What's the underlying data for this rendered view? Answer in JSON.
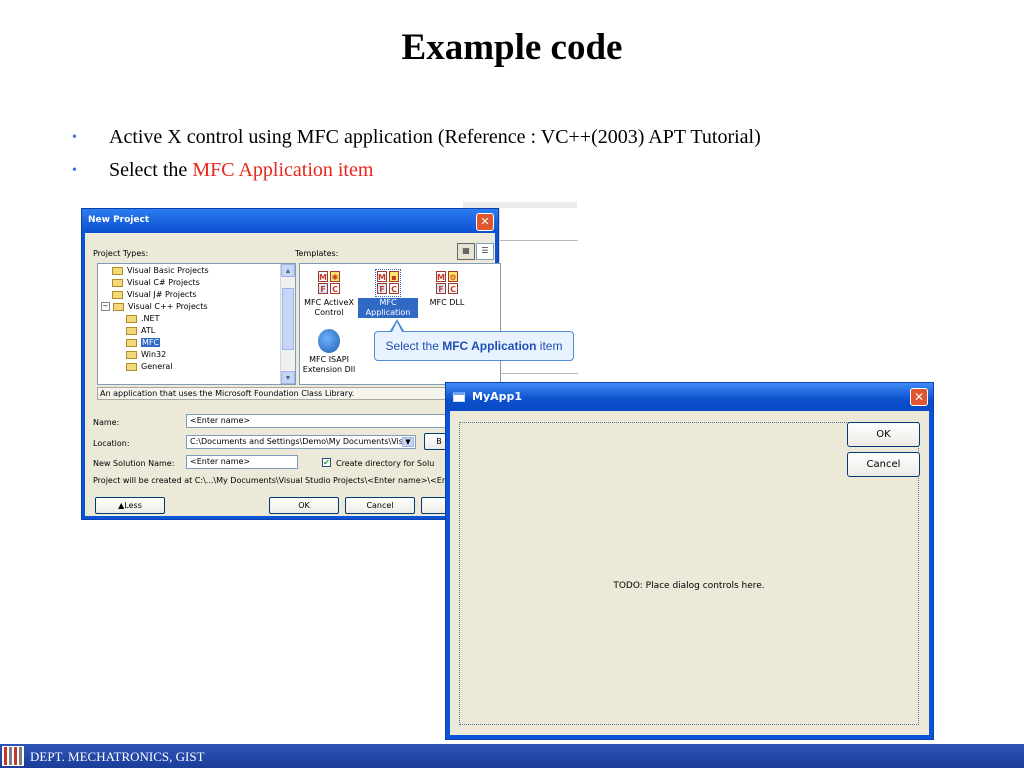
{
  "slide": {
    "title": "Example code",
    "bullet1": "Active X control using MFC application (Reference : VC++(2003) APT Tutorial)",
    "bullet2_prefix": "Select the ",
    "bullet2_highlight": "MFC Application item",
    "footer": "DEPT. MECHATRONICS, GIST"
  },
  "new_project": {
    "title": "New Project",
    "project_types_label": "Project Types:",
    "templates_label": "Templates:",
    "tree": [
      {
        "label": "Visual Basic Projects"
      },
      {
        "label": "Visual C# Projects"
      },
      {
        "label": "Visual J# Projects"
      },
      {
        "label": "Visual C++ Projects"
      },
      {
        "label": ".NET"
      },
      {
        "label": "ATL"
      },
      {
        "label": "MFC"
      },
      {
        "label": "Win32"
      },
      {
        "label": "General"
      }
    ],
    "templates": [
      {
        "label": "MFC ActiveX Control"
      },
      {
        "label": "MFC Application"
      },
      {
        "label": "MFC DLL"
      },
      {
        "label": "MFC ISAPI Extension Dll"
      }
    ],
    "description": "An application that uses the Microsoft Foundation Class Library.",
    "name_label": "Name:",
    "name_value": "<Enter name>",
    "location_label": "Location:",
    "location_value": "C:\\Documents and Settings\\Demo\\My Documents\\Visua",
    "browse_label": "B",
    "solution_label": "New Solution Name:",
    "solution_value": "<Enter name>",
    "create_dir_label": "Create directory for Solu",
    "create_dir_checked": true,
    "path_info": "Project will be created at C:\\...\\My Documents\\Visual Studio Projects\\<Enter name>\\<Enter",
    "less_button": "Less",
    "ok_button": "OK",
    "cancel_button": "Cancel"
  },
  "callout": {
    "prefix": "Select the ",
    "bold": "MFC Application",
    "suffix": " item"
  },
  "myapp": {
    "title": "MyApp1",
    "ok_button": "OK",
    "cancel_button": "Cancel",
    "todo_text": "TODO: Place dialog controls here."
  },
  "colors": {
    "titlebar_blue": "#0a54d8",
    "highlight_red": "#e8261b",
    "footer_blue": "#1c3d99"
  }
}
